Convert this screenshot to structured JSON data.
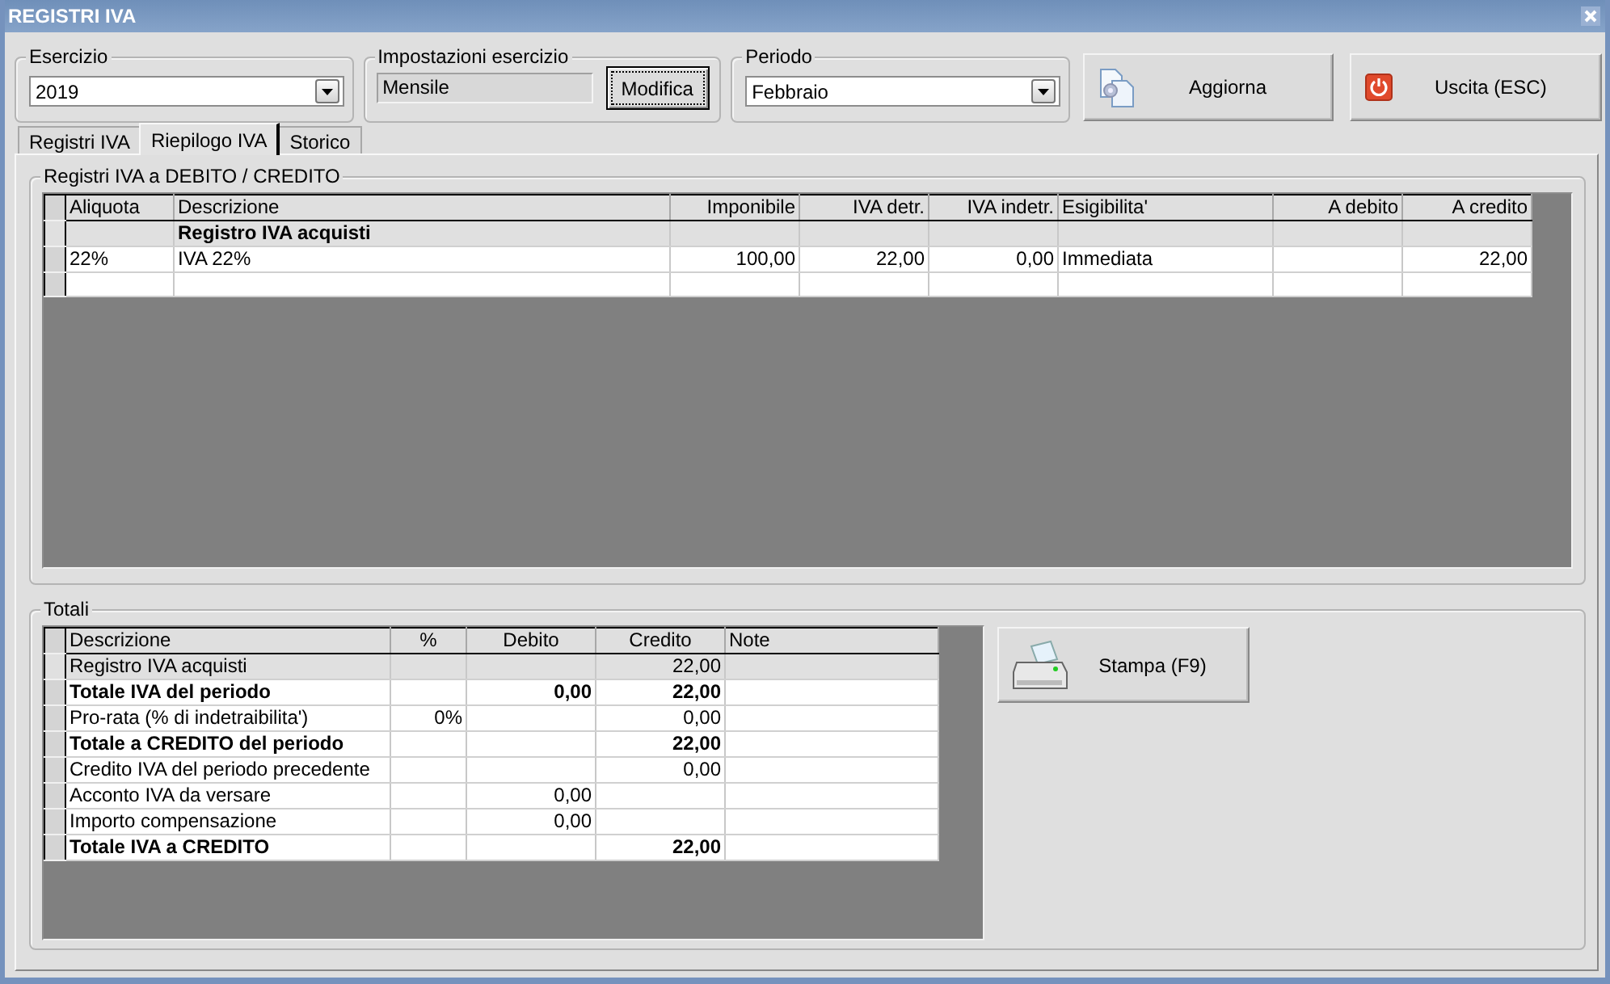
{
  "window": {
    "title": "REGISTRI IVA"
  },
  "esercizio": {
    "label": "Esercizio",
    "value": "2019"
  },
  "impostazioni": {
    "label": "Impostazioni esercizio",
    "value": "Mensile",
    "button": "Modifica",
    "focused": true
  },
  "periodo": {
    "label": "Periodo",
    "value": "Febbraio"
  },
  "actions": [
    {
      "label": "Aggiorna",
      "kind": "refresh"
    },
    {
      "label": "Uscita (ESC)",
      "kind": "exit"
    }
  ],
  "tabs": [
    {
      "label": "Registri IVA",
      "selected": false
    },
    {
      "label": "Riepilogo IVA",
      "selected": true
    },
    {
      "label": "Storico",
      "selected": false
    }
  ],
  "registri": {
    "label": "Registri IVA a DEBITO / CREDITO",
    "columns": [
      "Aliquota",
      "Descrizione",
      "Imponibile",
      "IVA detr.",
      "IVA indetr.",
      "Esigibilita'",
      "A debito",
      "A credito"
    ],
    "rows": [
      {
        "kind": "group",
        "cells": [
          null,
          "Registro IVA acquisti",
          null,
          null,
          null,
          null,
          null,
          null
        ]
      },
      {
        "kind": "item",
        "cells": [
          "22%",
          "IVA 22%",
          "100,00",
          "22,00",
          "0,00",
          "Immediata",
          null,
          "22,00"
        ]
      },
      {
        "kind": "blank"
      }
    ]
  },
  "totali": {
    "label": "Totali",
    "columns": [
      "Descrizione",
      "%",
      "Debito",
      "Credito",
      "Note"
    ],
    "rows": [
      {
        "kind": "section",
        "cells": [
          "Registro IVA acquisti",
          null,
          null,
          "22,00",
          null
        ]
      },
      {
        "kind": "total",
        "cells": [
          "Totale IVA del periodo",
          null,
          "0,00",
          "22,00",
          null
        ]
      },
      {
        "kind": "item",
        "cells": [
          "Pro-rata (% di indetraibilita')",
          "0%",
          null,
          "0,00",
          null
        ]
      },
      {
        "kind": "total",
        "cells": [
          "Totale a CREDITO del periodo",
          null,
          null,
          "22,00",
          null
        ]
      },
      {
        "kind": "item",
        "cells": [
          "Credito IVA del periodo precedente",
          null,
          null,
          "0,00",
          null
        ]
      },
      {
        "kind": "item",
        "cells": [
          "Acconto IVA da versare",
          null,
          "0,00",
          null,
          null
        ]
      },
      {
        "kind": "item",
        "cells": [
          "Importo compensazione",
          null,
          "0,00",
          null,
          null
        ]
      },
      {
        "kind": "total",
        "cells": [
          "Totale IVA a CREDITO",
          null,
          null,
          "22,00",
          null
        ]
      }
    ]
  },
  "print_button": {
    "label": "Stampa (F9)"
  }
}
